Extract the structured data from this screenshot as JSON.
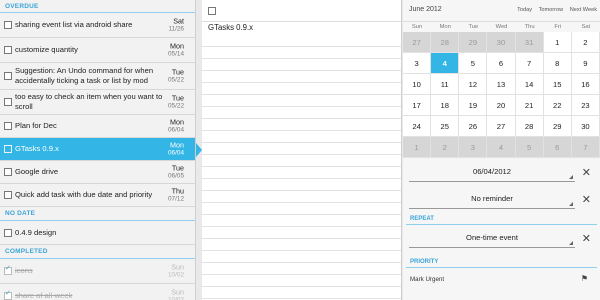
{
  "left": {
    "overdue_header": "OVERDUE",
    "overdue": [
      {
        "title": "sharing event list via android share",
        "dow": "Sat",
        "date": "11/26"
      },
      {
        "title": "customize quantity",
        "dow": "Mon",
        "date": "05/14"
      },
      {
        "title": "Suggestion: An Undo command for when accidentally ticking a task or list by mod",
        "dow": "Tue",
        "date": "05/22"
      },
      {
        "title": "too easy to check an item when you want to scroll",
        "dow": "Tue",
        "date": "05/22"
      },
      {
        "title": "Plan for Dec",
        "dow": "Mon",
        "date": "06/04"
      },
      {
        "title": "GTasks 0.9.x",
        "dow": "Mon",
        "date": "06/04",
        "selected": true
      },
      {
        "title": "Google drive",
        "dow": "Tue",
        "date": "06/05"
      },
      {
        "title": "Quick add task with due date and priority",
        "dow": "Thu",
        "date": "07/12"
      }
    ],
    "nodate_header": "NO DATE",
    "nodate": [
      {
        "title": "0.4.9 design"
      }
    ],
    "completed_header": "COMPLETED",
    "completed": [
      {
        "title": "icons",
        "dow": "Sun",
        "date": "10/02"
      },
      {
        "title": "share of all-week",
        "dow": "Sun",
        "date": "10/02"
      }
    ]
  },
  "middle": {
    "task_title": "GTasks 0.9.x"
  },
  "right": {
    "month": "June 2012",
    "quick_links": [
      "Today",
      "Tomorrow",
      "Next Week"
    ],
    "weekdays": [
      "Sun",
      "Mon",
      "Tue",
      "Wed",
      "Thu",
      "Fri",
      "Sat"
    ],
    "weeks": [
      [
        [
          "27",
          1
        ],
        [
          "28",
          1
        ],
        [
          "29",
          1
        ],
        [
          "30",
          1
        ],
        [
          "31",
          1
        ],
        [
          "1",
          0
        ],
        [
          "2",
          0
        ]
      ],
      [
        [
          "3",
          0
        ],
        [
          "4",
          2
        ],
        [
          "5",
          0
        ],
        [
          "6",
          0
        ],
        [
          "7",
          0
        ],
        [
          "8",
          0
        ],
        [
          "9",
          0
        ]
      ],
      [
        [
          "10",
          0
        ],
        [
          "11",
          0
        ],
        [
          "12",
          0
        ],
        [
          "13",
          0
        ],
        [
          "14",
          0
        ],
        [
          "15",
          0
        ],
        [
          "16",
          0
        ]
      ],
      [
        [
          "17",
          0
        ],
        [
          "18",
          0
        ],
        [
          "19",
          0
        ],
        [
          "20",
          0
        ],
        [
          "21",
          0
        ],
        [
          "22",
          0
        ],
        [
          "23",
          0
        ]
      ],
      [
        [
          "24",
          0
        ],
        [
          "25",
          0
        ],
        [
          "26",
          0
        ],
        [
          "27",
          0
        ],
        [
          "28",
          0
        ],
        [
          "29",
          0
        ],
        [
          "30",
          0
        ]
      ],
      [
        [
          "1",
          1
        ],
        [
          "2",
          1
        ],
        [
          "3",
          1
        ],
        [
          "4",
          1
        ],
        [
          "5",
          1
        ],
        [
          "6",
          1
        ],
        [
          "7",
          1
        ]
      ]
    ],
    "due_date": "06/04/2012",
    "reminder": "No reminder",
    "repeat_header": "REPEAT",
    "repeat_value": "One-time event",
    "priority_header": "PRIORITY",
    "mark_urgent": "Mark Urgent",
    "colors": {
      "accent": "#33b5e5",
      "header_text": "#3aa4d8"
    }
  }
}
